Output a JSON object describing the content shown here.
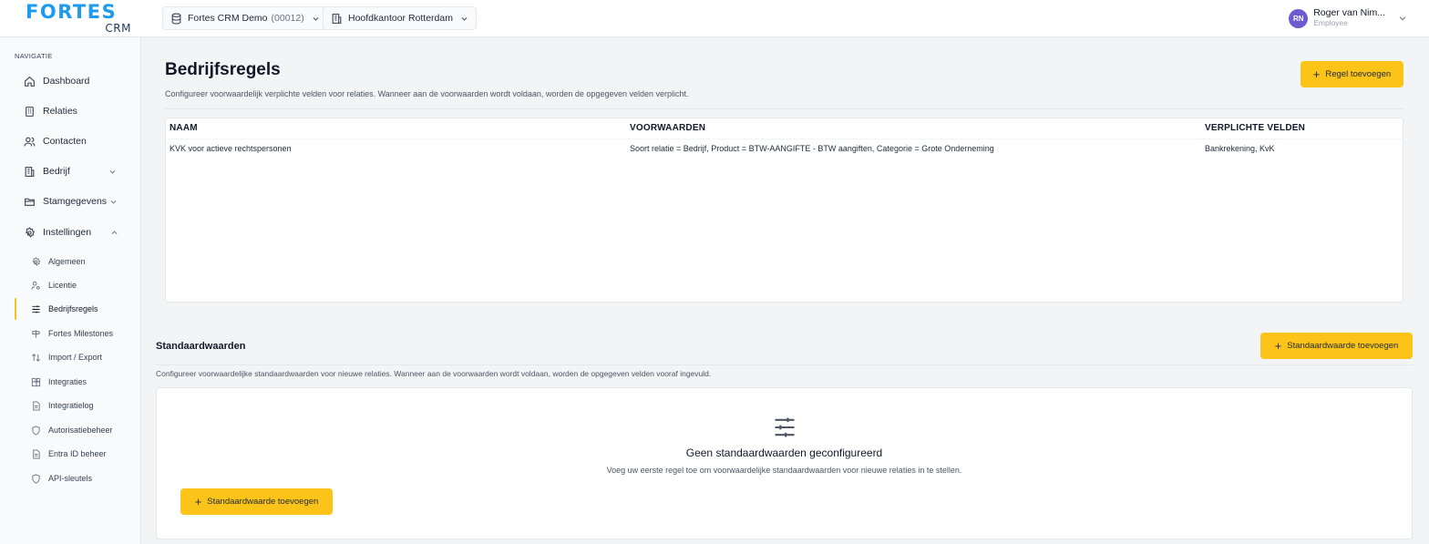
{
  "header": {
    "logo_main": "FORTES",
    "logo_sub": "CRM",
    "company_selector": {
      "label": "Fortes CRM Demo",
      "code": "(00012)"
    },
    "office_selector": {
      "label": "Hoofdkantoor Rotterdam"
    },
    "user": {
      "initials": "RN",
      "name": "Roger van Nim...",
      "role": "Employee"
    }
  },
  "sidebar": {
    "title": "NAVIGATIE",
    "items": [
      {
        "label": "Dashboard",
        "icon": "home-icon"
      },
      {
        "label": "Relaties",
        "icon": "building-icon"
      },
      {
        "label": "Contacten",
        "icon": "users-icon"
      },
      {
        "label": "Bedrijf",
        "icon": "office-icon"
      },
      {
        "label": "Stamgegevens",
        "icon": "folder-icon"
      },
      {
        "label": "Instellingen",
        "icon": "gear-icon"
      }
    ],
    "sub_items": [
      {
        "label": "Algemeen",
        "icon": "gear-icon"
      },
      {
        "label": "Licentie",
        "icon": "user-key-icon"
      },
      {
        "label": "Bedrijfsregels",
        "icon": "sliders-icon",
        "active": true
      },
      {
        "label": "Fortes Milestones",
        "icon": "signpost-icon"
      },
      {
        "label": "Import / Export",
        "icon": "arrows-icon"
      },
      {
        "label": "Integraties",
        "icon": "blocks-icon"
      },
      {
        "label": "Integratielog",
        "icon": "file-icon"
      },
      {
        "label": "Autorisatiebeheer",
        "icon": "shield-icon"
      },
      {
        "label": "Entra ID beheer",
        "icon": "file-icon"
      },
      {
        "label": "API-sleutels",
        "icon": "shield-icon"
      }
    ]
  },
  "main": {
    "title": "Bedrijfsregels",
    "description": "Configureer voorwaardelijk verplichte velden voor relaties. Wanneer aan de voorwaarden wordt voldaan, worden de opgegeven velden verplicht.",
    "add_rule_label": "Regel toevoegen",
    "table": {
      "columns": [
        "NAAM",
        "VOORWAARDEN",
        "VERPLICHTE VELDEN"
      ],
      "rows": [
        [
          "KVK voor actieve rechtspersonen",
          "Soort relatie = Bedrijf, Product = BTW-AANGIFTE - BTW aangiften, Categorie = Grote Onderneming",
          "Bankrekening, KvK"
        ]
      ]
    }
  },
  "defaults": {
    "title": "Standaardwaarden",
    "add_label": "Standaardwaarde toevoegen",
    "description": "Configureer voorwaardelijke standaardwaarden voor nieuwe relaties. Wanneer aan de voorwaarden wordt voldaan, worden de opgegeven velden vooraf ingevuld.",
    "empty_title": "Geen standaardwaarden geconfigureerd",
    "empty_description": "Voeg uw eerste regel toe om voorwaardelijke standaardwaarden voor nieuwe relaties in te stellen.",
    "empty_button_label": "Standaardwaarde toevoegen"
  },
  "colors": {
    "accent": "#fcc419",
    "logo": "#1d9bf0",
    "avatar": "#6d5bd0"
  }
}
